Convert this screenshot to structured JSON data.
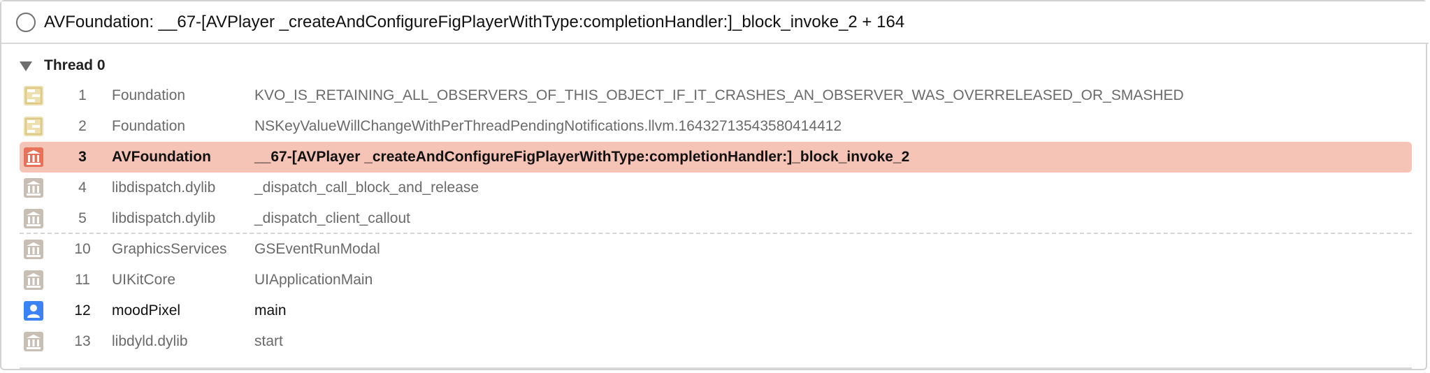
{
  "header": {
    "title": "AVFoundation: __67-[AVPlayer _createAndConfigureFigPlayerWithType:completionHandler:]_block_invoke_2 + 164"
  },
  "thread": {
    "label": "Thread 0"
  },
  "colors": {
    "highlight": "#f6c4b6",
    "framework_icon": "#e8d49a",
    "system_icon": "#c8beb4",
    "highlight_icon": "#e8715a",
    "user_icon": "#3b82f6"
  },
  "frames": [
    {
      "num": "1",
      "lib": "Foundation",
      "sym": "KVO_IS_RETAINING_ALL_OBSERVERS_OF_THIS_OBJECT_IF_IT_CRASHES_AN_OBSERVER_WAS_OVERRELEASED_OR_SMASHED",
      "icon": "framework-icon"
    },
    {
      "num": "2",
      "lib": "Foundation",
      "sym": "NSKeyValueWillChangeWithPerThreadPendingNotifications.llvm.16432713543580414412",
      "icon": "framework-icon"
    },
    {
      "num": "3",
      "lib": "AVFoundation",
      "sym": "__67-[AVPlayer _createAndConfigureFigPlayerWithType:completionHandler:]_block_invoke_2",
      "icon": "library-icon"
    },
    {
      "num": "4",
      "lib": "libdispatch.dylib",
      "sym": "_dispatch_call_block_and_release",
      "icon": "library-icon"
    },
    {
      "num": "5",
      "lib": "libdispatch.dylib",
      "sym": "_dispatch_client_callout",
      "icon": "library-icon"
    },
    {
      "num": "10",
      "lib": "GraphicsServices",
      "sym": "GSEventRunModal",
      "icon": "library-icon"
    },
    {
      "num": "11",
      "lib": "UIKitCore",
      "sym": "UIApplicationMain",
      "icon": "library-icon"
    },
    {
      "num": "12",
      "lib": "moodPixel",
      "sym": "main",
      "icon": "user-icon"
    },
    {
      "num": "13",
      "lib": "libdyld.dylib",
      "sym": "start",
      "icon": "library-icon"
    }
  ]
}
